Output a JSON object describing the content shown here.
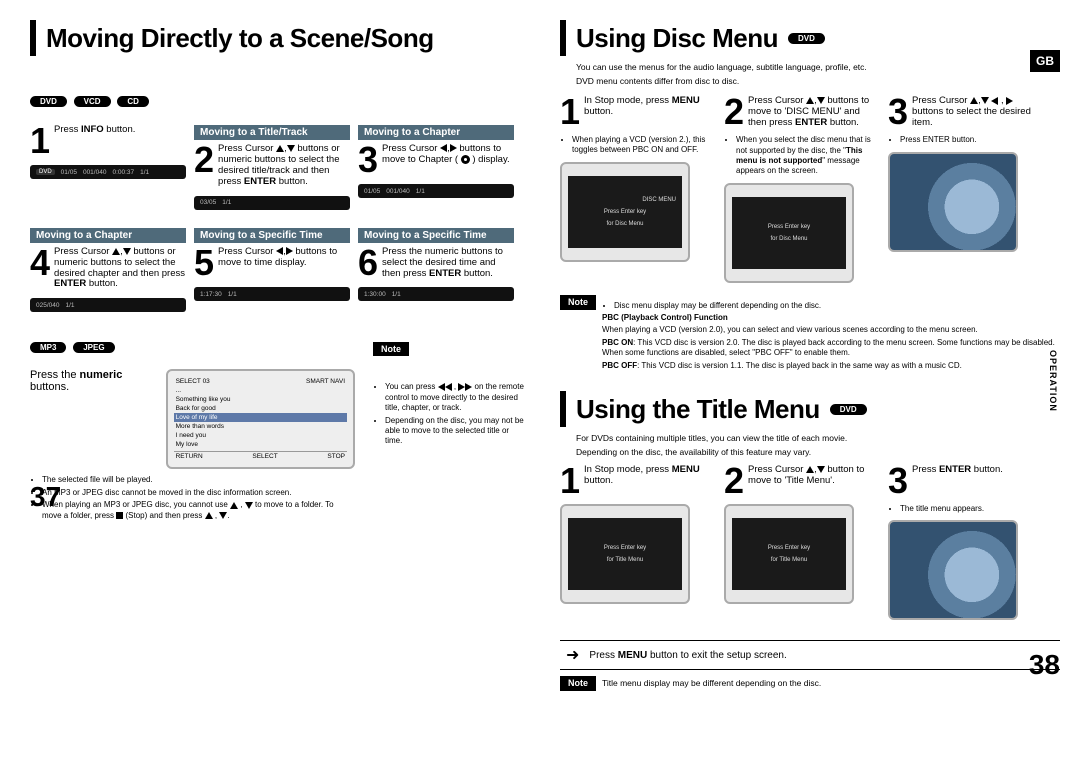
{
  "left_page": {
    "title": "Moving Directly to a Scene/Song",
    "badges_top": [
      "DVD",
      "VCD",
      "CD"
    ],
    "steps_r1": [
      {
        "num": "1",
        "header": "",
        "text": "Press <b>INFO</b> button."
      },
      {
        "num": "2",
        "header": "Moving to a Title/Track",
        "text": "Press Cursor <span class='tri up'></span>,<span class='tri down'></span> buttons or numeric buttons to select the desired title/track and then press <b>ENTER</b> button."
      },
      {
        "num": "3",
        "header": "Moving to a Chapter",
        "text": "Press Cursor <span class='tri left'></span>,<span class='tri right'></span> buttons to move to Chapter ( <span class='disc-icon'></span> ) display."
      }
    ],
    "bars_r1": [
      [
        "DVD",
        "01/05",
        "001/040",
        "0:00:37",
        "1/1"
      ],
      [
        "",
        "03/05",
        "",
        "",
        "1/1"
      ],
      [
        "",
        "01/05",
        "001/040",
        "",
        "1/1"
      ]
    ],
    "steps_r2": [
      {
        "num": "4",
        "header": "Moving to a Chapter",
        "text": "Press Cursor <span class='tri up'></span>,<span class='tri down'></span> buttons or numeric buttons to select the desired chapter and then press <b>ENTER</b> button."
      },
      {
        "num": "5",
        "header": "Moving to a Specific Time",
        "text": "Press Cursor <span class='tri left'></span>,<span class='tri right'></span> buttons to move to time display."
      },
      {
        "num": "6",
        "header": "Moving to a Specific Time",
        "text": "Press the numeric buttons to select the desired time and then press <b>ENTER</b> button."
      }
    ],
    "bars_r2": [
      [
        "",
        "",
        "025/040",
        "",
        "1/1"
      ],
      [
        "",
        "",
        "",
        "1:17:30",
        "1/1"
      ],
      [
        "",
        "",
        "",
        "1:30:00",
        "1/1"
      ]
    ],
    "badges_mid": [
      "MP3",
      "JPEG"
    ],
    "press_numeric": "Press the <b>numeric</b> buttons.",
    "bullets_bottom": [
      "The selected file will be played.",
      "An MP3 or JPEG disc cannot be moved in the disc information screen.",
      "When playing an MP3 or JPEG disc, you cannot use <span class='tri up'></span> , <span class='tri down'></span> to move to a folder. To move a folder, press <span class='stop-icon'></span> (Stop) and then press <span class='tri up'></span> , <span class='tri down'></span>."
    ],
    "mp3_list": {
      "select_label": "SELECT   03",
      "right_label": "SMART NAVI",
      "rows": [
        "...",
        "Something like you",
        "Back for good",
        "Love of my life",
        "More than words",
        "I need you",
        "My love"
      ],
      "highlight_idx": 3,
      "footer": [
        "RETURN",
        "SELECT",
        "STOP"
      ]
    },
    "note_label": "Note",
    "note_bullets": [
      "You can press <span class='tri left'></span><span class='tri left'></span> , <span class='tri right'></span><span class='tri right'></span> on the remote control to move directly to the desired title, chapter, or track.",
      "Depending on the disc, you may not be able to move to the selected title or time."
    ],
    "pagenum": "37"
  },
  "right_page": {
    "disc_menu": {
      "title": "Using Disc Menu",
      "badge": "DVD",
      "intro_lines": [
        "You can use the menus for the audio language, subtitle language, profile, etc.",
        "DVD menu contents differ from disc to disc."
      ],
      "steps": [
        {
          "num": "1",
          "text": "In Stop mode, press <b>MENU</b> button.",
          "bullets": [
            "When playing a VCD (version 2.), this toggles between PBC ON and OFF."
          ]
        },
        {
          "num": "2",
          "text": "Press Cursor <span class='tri up'></span>,<span class='tri down'></span> buttons to move to 'DISC MENU' and then press <b>ENTER</b> button.",
          "bullets": [
            "When you select the disc menu that is not supported by the disc, the \"<b>This menu is not supported</b>\" message appears on the screen."
          ]
        },
        {
          "num": "3",
          "text": "Press Cursor <span class='tri up'></span>,<span class='tri down'></span> <span class='tri left'></span> , <span class='tri right'></span> buttons to select the desired item.",
          "bullets": [
            "Press ENTER button."
          ]
        }
      ],
      "tv_text": {
        "top": "DISC MENU",
        "l1": "Press Enter key",
        "l2": "for Disc Menu"
      },
      "note_label": "Note",
      "note_lines": [
        "Disc menu display may be different depending on the disc.",
        "<b>PBC (Playback Control) Function</b>",
        "When playing a VCD (version 2.0), you can select and view various scenes according to the menu screen.",
        "<b>PBC ON</b>: This VCD disc is version 2.0. The disc is played back according to the menu screen. Some functions may be disabled. When some functions are disabled, select \"PBC OFF\" to enable them.",
        "<b>PBC OFF</b>: This VCD disc is version 1.1. The disc is played back in the same way as with a music CD."
      ]
    },
    "title_menu": {
      "title": "Using the Title Menu",
      "badge": "DVD",
      "intro_lines": [
        "For DVDs containing multiple titles, you can view the title of each movie.",
        "Depending on the disc, the availability of this feature may vary."
      ],
      "steps": [
        {
          "num": "1",
          "text": "In Stop mode, press <b>MENU</b> button."
        },
        {
          "num": "2",
          "text": "Press Cursor <span class='tri up'></span>,<span class='tri down'></span> button to move to 'Title Menu'."
        },
        {
          "num": "3",
          "text": "Press <b>ENTER</b> button.",
          "bullets": [
            "The title menu appears."
          ]
        }
      ],
      "tv_text": {
        "l1": "Press Enter key",
        "l2": "for Title Menu"
      },
      "exit_bar": "Press <b>MENU</b> button to exit the setup screen.",
      "note_label": "Note",
      "note_line": "Title menu display may be different depending on the disc."
    },
    "side_tab": "OPERATION",
    "corner": "GB",
    "pagenum": "38"
  }
}
